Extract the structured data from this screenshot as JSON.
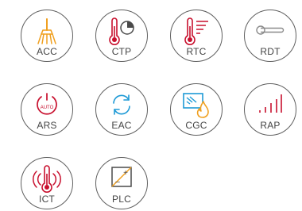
{
  "colors": {
    "orange": "#f0a020",
    "red": "#c8102e",
    "blue": "#1e9ad6",
    "dark": "#4a4a4a",
    "gray": "#8a8a8a"
  },
  "badges": [
    {
      "code": "ACC",
      "icon": "broom-icon"
    },
    {
      "code": "CTP",
      "icon": "thermometer-clock-icon"
    },
    {
      "code": "RTC",
      "icon": "thermometer-lines-icon"
    },
    {
      "code": "RDT",
      "icon": "door-handle-icon"
    },
    {
      "code": "ARS",
      "icon": "auto-power-icon",
      "icon_text": "AUTO"
    },
    {
      "code": "EAC",
      "icon": "refresh-cycle-icon"
    },
    {
      "code": "CGC",
      "icon": "glass-flame-icon"
    },
    {
      "code": "RAP",
      "icon": "signal-bars-icon"
    },
    {
      "code": "ICT",
      "icon": "thermometer-waves-icon"
    },
    {
      "code": "PLC",
      "icon": "plus-minus-panel-icon",
      "icon_text_plus": "+",
      "icon_text_minus": "–"
    }
  ]
}
